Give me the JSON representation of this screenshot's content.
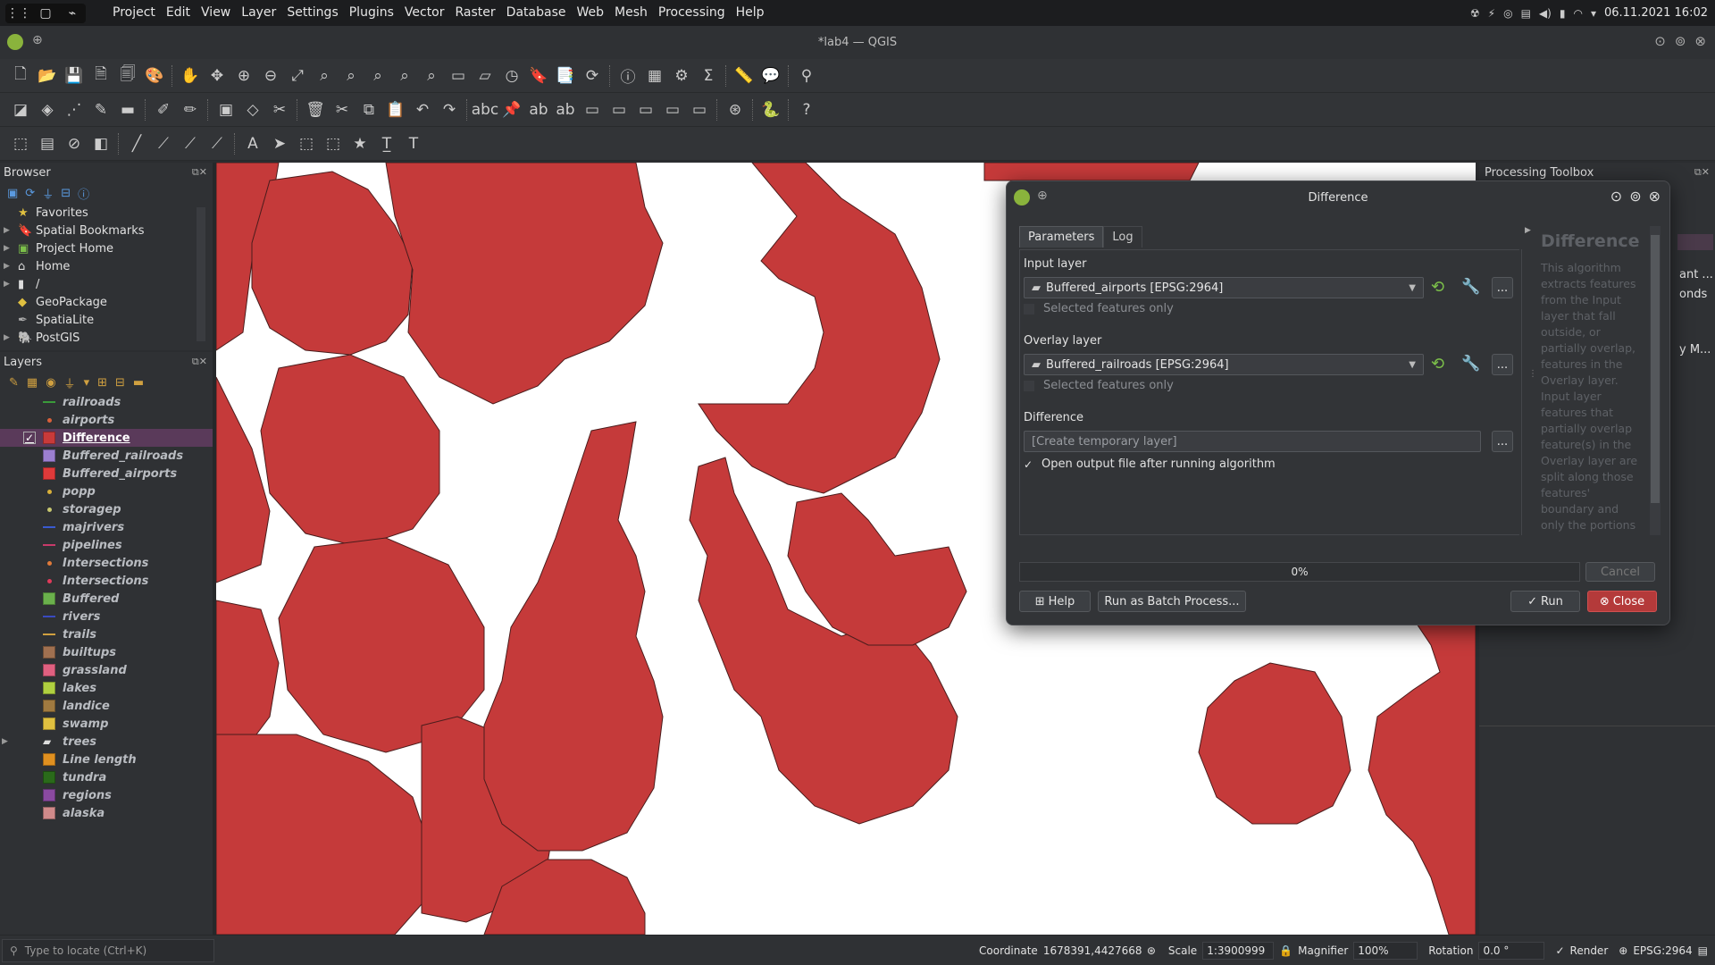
{
  "menubar": {
    "items": [
      "Project",
      "Edit",
      "View",
      "Layer",
      "Settings",
      "Plugins",
      "Vector",
      "Raster",
      "Database",
      "Web",
      "Mesh",
      "Processing",
      "Help"
    ],
    "clock": "06.11.2021 16:02"
  },
  "window": {
    "title": "*lab4 — QGIS"
  },
  "browser": {
    "title": "Browser",
    "items": [
      "Favorites",
      "Spatial Bookmarks",
      "Project Home",
      "Home",
      "/",
      "GeoPackage",
      "SpatiaLite",
      "PostGIS"
    ]
  },
  "layers": {
    "title": "Layers",
    "items": [
      {
        "name": "railroads",
        "color": "#3a9a3a",
        "kind": "line",
        "checked": false
      },
      {
        "name": "airports",
        "color": "#d9603a",
        "kind": "point",
        "checked": false
      },
      {
        "name": "Difference",
        "color": "#c83a3a",
        "kind": "fill",
        "checked": true
      },
      {
        "name": "Buffered_railroads",
        "color": "#9b7fd0",
        "kind": "fill",
        "checked": false
      },
      {
        "name": "Buffered_airports",
        "color": "#e03a3a",
        "kind": "fill",
        "checked": false
      },
      {
        "name": "popp",
        "color": "#d9b03a",
        "kind": "point",
        "checked": false
      },
      {
        "name": "storagep",
        "color": "#c8c870",
        "kind": "point",
        "checked": false
      },
      {
        "name": "majrivers",
        "color": "#3a5ad0",
        "kind": "line",
        "checked": false
      },
      {
        "name": "pipelines",
        "color": "#c83a6a",
        "kind": "line",
        "checked": false
      },
      {
        "name": "Intersections",
        "color": "#e07a3a",
        "kind": "point",
        "checked": false
      },
      {
        "name": "Intersections",
        "color": "#e03a5a",
        "kind": "point",
        "checked": false
      },
      {
        "name": "Buffered",
        "color": "#6ab04c",
        "kind": "fill",
        "checked": false
      },
      {
        "name": "rivers",
        "color": "#3a4ac0",
        "kind": "line",
        "checked": false
      },
      {
        "name": "trails",
        "color": "#d0a040",
        "kind": "line",
        "checked": false
      },
      {
        "name": "builtups",
        "color": "#a07050",
        "kind": "fill",
        "checked": false
      },
      {
        "name": "grassland",
        "color": "#e06080",
        "kind": "fill",
        "checked": false
      },
      {
        "name": "lakes",
        "color": "#b0d040",
        "kind": "fill",
        "checked": false
      },
      {
        "name": "landice",
        "color": "#a07a40",
        "kind": "fill",
        "checked": false
      },
      {
        "name": "swamp",
        "color": "#e0c040",
        "kind": "fill",
        "checked": false
      },
      {
        "name": "trees",
        "color": "#dddddd",
        "kind": "group",
        "checked": false
      },
      {
        "name": "Line length",
        "color": "#e09020",
        "kind": "fill",
        "checked": false
      },
      {
        "name": "tundra",
        "color": "#2a6a1a",
        "kind": "fill",
        "checked": false
      },
      {
        "name": "regions",
        "color": "#8a4aa0",
        "kind": "fill",
        "checked": false
      },
      {
        "name": "alaska",
        "color": "#d08a8a",
        "kind": "fill",
        "checked": false
      }
    ]
  },
  "toolbox": {
    "title": "Processing Toolbox",
    "peek1": "ant ...",
    "peek2": "onds",
    "peek3": "y M..."
  },
  "dialog": {
    "title": "Difference",
    "tabs": [
      "Parameters",
      "Log"
    ],
    "input_label": "Input layer",
    "input_value": "Buffered_airports [EPSG:2964]",
    "selected_only_1": "Selected features only",
    "overlay_label": "Overlay layer",
    "overlay_value": "Buffered_railroads [EPSG:2964]",
    "selected_only_2": "Selected features only",
    "output_label": "Difference",
    "output_placeholder": "[Create temporary layer]",
    "open_output": "Open output file after running algorithm",
    "progress_text": "0%",
    "progress": 0,
    "cancel": "Cancel",
    "help": "Help",
    "batch": "Run as Batch Process...",
    "run": "Run",
    "close": "Close",
    "browse": "...",
    "help_title": "Difference",
    "help_text": "This algorithm extracts features from the Input layer that fall outside, or partially overlap, features in the Overlay layer. Input layer features that partially overlap feature(s) in the Overlay layer are split along those features' boundary and only the portions"
  },
  "statusbar": {
    "locate_placeholder": "Type to locate (Ctrl+K)",
    "coordinate_label": "Coordinate",
    "coordinate_value": "1678391,4427668",
    "scale_label": "Scale",
    "scale_value": "1:3900999",
    "magnifier_label": "Magnifier",
    "magnifier_value": "100%",
    "rotation_label": "Rotation",
    "rotation_value": "0.0 °",
    "render_label": "Render",
    "crs": "EPSG:2964"
  }
}
